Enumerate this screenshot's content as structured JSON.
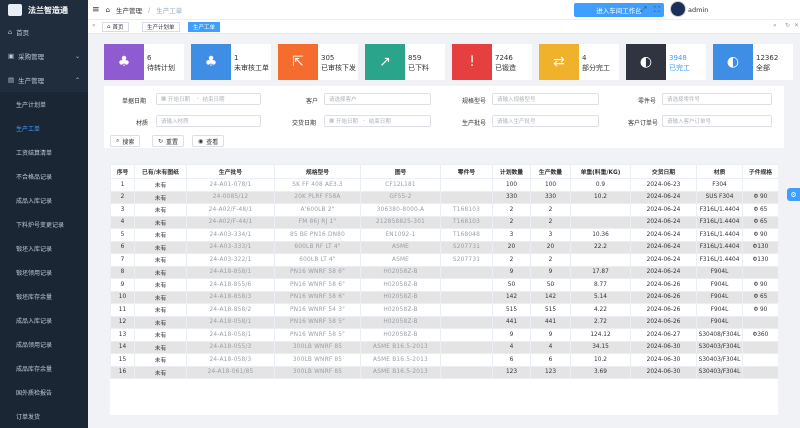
{
  "app": {
    "title": "法兰智造通"
  },
  "sidebar": {
    "items": [
      {
        "label": "首页",
        "icon": "home-icon"
      },
      {
        "label": "采购管理",
        "icon": "cart-icon"
      },
      {
        "label": "生产管理",
        "icon": "factory-icon"
      }
    ],
    "sub": [
      "生产计划单",
      "生产工单",
      "工资结算清单",
      "不合格品记录",
      "成品入库记录",
      "下料炉号变更记录",
      "锻坯入库记录",
      "锻坯领用记录",
      "锻坯库存余量",
      "成品入库记录",
      "成品领用记录",
      "成品库存余量",
      "国外质检报告",
      "订单发货"
    ]
  },
  "topbar": {
    "breadcrumb_home": "生产管理",
    "breadcrumb_sep": "/",
    "breadcrumb_current": "生产工单",
    "workshop_button": "进入车间工作台",
    "user": "admin"
  },
  "tags": [
    "首页",
    "生产计划单",
    "生产工单"
  ],
  "cards": [
    {
      "num": "6",
      "label": "待转计划",
      "color": "#8e5bd1",
      "icon": "tree-icon"
    },
    {
      "num": "1",
      "label": "未审核工单",
      "color": "#3d8ee4",
      "icon": "tree-icon"
    },
    {
      "num": "305",
      "label": "已审核下发",
      "color": "#f56c2f",
      "icon": "share-icon"
    },
    {
      "num": "859",
      "label": "已下料",
      "color": "#2aa58b",
      "icon": "arrow-up-right-icon"
    },
    {
      "num": "7246",
      "label": "已锻造",
      "color": "#e53f3f",
      "icon": "alert-icon"
    },
    {
      "num": "4",
      "label": "部分完工",
      "color": "#f0b22a",
      "icon": "swap-icon"
    },
    {
      "num": "3948",
      "label": "已完工",
      "color": "#2f3440",
      "icon": "toggle-icon"
    },
    {
      "num": "12362",
      "label": "全部",
      "color": "#3d8ee4",
      "icon": "toggle-icon"
    }
  ],
  "filter": {
    "order_date": "单据日期",
    "start_date": "开始日期",
    "dash": "-",
    "end_date": "结束日期",
    "customer": "客户",
    "customer_ph": "请选择客户",
    "spec": "规格型号",
    "spec_ph": "请输入规格型号",
    "part": "零件号",
    "part_ph": "请选择零件号",
    "material": "材质",
    "material_ph": "请输入材质",
    "delivery": "交货日期",
    "delivery_start": "开始日期",
    "delivery_end": "结束日期",
    "batch": "生产批号",
    "batch_ph": "请输入生产批号",
    "cust_order": "客户订单号",
    "cust_order_ph": "请输入客户订单号",
    "search": "搜索",
    "reset": "重置",
    "view": "查看"
  },
  "table": {
    "headers": [
      "序号",
      "已有/未有图纸",
      "生产批号",
      "规格型号",
      "图号",
      "零件号",
      "计划数量",
      "生产数量",
      "单重(料重/KG)",
      "交货日期",
      "材质",
      "子件规格"
    ],
    "rows": [
      [
        "1",
        "未有",
        "24-A01-078/1",
        "SK FF 408 AE3.3",
        "CF12L181",
        "",
        "100",
        "100",
        "0.9",
        "2024-06-23",
        "F304",
        ""
      ],
      [
        "2",
        "未有",
        "24-0085/12",
        "20K PLRF F58A",
        "GF55-2",
        "",
        "330",
        "330",
        "10.2",
        "2024-06-24",
        "SUS F304",
        "Φ 90"
      ],
      [
        "3",
        "未有",
        "24-A02/F-48/1",
        "A'600LB 2\"",
        "306380-8000-A",
        "T168103",
        "2",
        "2",
        "",
        "2024-06-24",
        "F316L/1.4404",
        "Φ 65"
      ],
      [
        "4",
        "未有",
        "24-A02/F-44/1",
        "FM 86J RJ 1\"",
        "212858825-301",
        "T168103",
        "2",
        "2",
        "",
        "2024-06-24",
        "F316L/1.4404",
        "Φ 65"
      ],
      [
        "5",
        "未有",
        "24-A03-334/1",
        "85 BE PN16 DN80",
        "EN1092-1",
        "T168048",
        "3",
        "3",
        "10.36",
        "2024-06-24",
        "F316L/1.4404",
        "Φ 90"
      ],
      [
        "6",
        "未有",
        "24-A03-333/1",
        "600LB RF LT 4\"",
        "ASME",
        "S207731",
        "20",
        "20",
        "22.2",
        "2024-06-24",
        "F316L/1.4404",
        "Φ130"
      ],
      [
        "7",
        "未有",
        "24-A03-322/1",
        "600LB LT 4\"",
        "ASME",
        "S207731",
        "2",
        "2",
        "",
        "2024-06-24",
        "F316L/1.4404",
        "Φ130"
      ],
      [
        "8",
        "未有",
        "24-A18-858/1",
        "PN16 WNRF 58 6\"",
        "H02058Z-B",
        "",
        "9",
        "9",
        "17.87",
        "2024-06-24",
        "F904L",
        ""
      ],
      [
        "9",
        "未有",
        "24-A18-855/6",
        "PN16 WNRF 58 6\"",
        "H02058Z-B",
        "",
        "50",
        "50",
        "8.77",
        "2024-06-26",
        "F904L",
        "Φ 90"
      ],
      [
        "10",
        "未有",
        "24-A18-858/3",
        "PN16 WNRF 58 6\"",
        "H02058Z-B",
        "",
        "142",
        "142",
        "5.14",
        "2024-06-26",
        "F904L",
        "Φ 65"
      ],
      [
        "11",
        "未有",
        "24-A18-858/2",
        "PN16 WNRF 54 3\"",
        "H02058Z-B",
        "",
        "515",
        "515",
        "4.22",
        "2024-06-26",
        "F904L",
        "Φ 90"
      ],
      [
        "12",
        "未有",
        "24-A18-058/1",
        "PN16 WNRF 58 5\"",
        "H02058Z-B",
        "",
        "441",
        "441",
        "2.72",
        "2024-06-26",
        "F904L",
        ""
      ],
      [
        "13",
        "未有",
        "24-A18-058/1",
        "PN16 WNRF 58 5\"",
        "H02058Z-B",
        "",
        "9",
        "9",
        "124.12",
        "2024-06-27",
        "S30408/F304L",
        "Φ360"
      ],
      [
        "14",
        "未有",
        "24-A18-055/3",
        "300LB WNRF 85",
        "ASME B16.5-2013",
        "",
        "4",
        "4",
        "34.15",
        "2024-06-30",
        "S30403/F304L",
        ""
      ],
      [
        "15",
        "未有",
        "24-A18-058/3",
        "300LB WNRF 85",
        "ASME B16.5-2013",
        "",
        "6",
        "6",
        "10.2",
        "2024-06-30",
        "S30403/F304L",
        ""
      ],
      [
        "16",
        "未有",
        "24-A18-061/85",
        "300LB WNRF 85",
        "ASME B16.5-2013",
        "",
        "123",
        "123",
        "3.69",
        "2024-06-30",
        "S30403/F304L",
        ""
      ]
    ]
  }
}
